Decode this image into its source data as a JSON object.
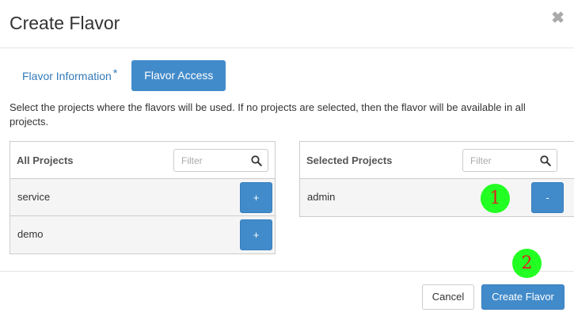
{
  "dialog": {
    "title": "Create Flavor",
    "close_glyph": "✖"
  },
  "tabs": {
    "info_label": "Flavor Information",
    "required_mark": "*",
    "access_label": "Flavor Access"
  },
  "description": "Select the projects where the flavors will be used. If no projects are selected, then the flavor will be available in all projects.",
  "all_projects": {
    "title": "All Projects",
    "filter_placeholder": "Filter",
    "items": [
      {
        "name": "service",
        "action": "+"
      },
      {
        "name": "demo",
        "action": "+"
      }
    ]
  },
  "selected_projects": {
    "title": "Selected Projects",
    "filter_placeholder": "Filter",
    "items": [
      {
        "name": "admin",
        "action": "-"
      }
    ]
  },
  "footer": {
    "cancel_label": "Cancel",
    "create_label": "Create Flavor"
  },
  "annotations": {
    "marker_1": "1",
    "marker_2": "2"
  },
  "colors": {
    "primary": "#428bca",
    "link": "#337ab7",
    "marker_fill": "#22ff22",
    "marker_text": "#e02020"
  }
}
